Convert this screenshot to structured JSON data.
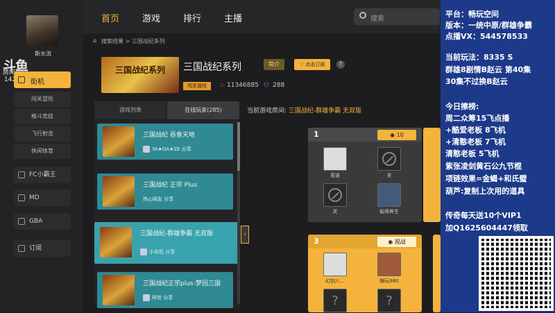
{
  "sidebar": {
    "username": "斯水流",
    "watermark": {
      "logo": "斗鱼",
      "room": "房间号",
      "id": "1425"
    },
    "active_item": "街机",
    "sub_items": [
      "闯关冒险",
      "格斗竞技",
      "飞行射击",
      "休闲体育"
    ],
    "items": [
      "FC小霸王",
      "MD",
      "GBA",
      "订阅"
    ]
  },
  "nav": {
    "items": [
      "首页",
      "游戏",
      "排行",
      "主播"
    ],
    "search_placeholder": "搜索"
  },
  "breadcrumb": [
    "搜索结果",
    "三国战纪系列"
  ],
  "game": {
    "banner_text": "三国战纪系列",
    "title": "三国战纪系列",
    "intro_label": "简介",
    "subscribe_label": "点击订阅",
    "tag": "闯关冒险",
    "popularity": "11346885",
    "followers": "288"
  },
  "tabs": {
    "list": "游戏列表",
    "players": "在线玩家(285)"
  },
  "current_room": {
    "label": "当前游戏房间:",
    "value": "三国战纪-群雄争霸 无双版"
  },
  "game_list": [
    {
      "title": "三国战纪 吞食天地",
      "user": "YA★OA★ZE",
      "share": "分享"
    },
    {
      "title": "三国战纪 正宗 Plus",
      "user": "热心网友",
      "share": "分享"
    },
    {
      "title": "三国战纪-群雄争霸 无双版",
      "user": "小灰机",
      "share": "分享"
    },
    {
      "title": "三国战纪正宗plus-梦回三国",
      "user": "阿信",
      "share": "分享"
    }
  ],
  "rooms": [
    {
      "num": "1",
      "badge": "10",
      "seats": [
        "宵诺",
        "关",
        "关",
        "偷师养生"
      ]
    },
    {
      "num": "3",
      "badge": "观战",
      "seats": [
        "幻剑八...",
        "狮玩980"
      ]
    }
  ],
  "overlay": {
    "lines_top": [
      "平台：畅玩空间",
      "版本：一统中原/群雄争霸",
      "点播VX：544578533"
    ],
    "lines_mid": [
      "当前玩法：8335 S",
      "群雄8剧情B赵云 第40集",
      "30集不过换B赵云"
    ],
    "lines_today": [
      "今日擦榜:",
      "周二众筹15飞点播",
      "+酷爱老板 8飞机",
      "+清憨老板 7飞机",
      "清憨老板 5飞机",
      "  紫张凌剑黄石公九节棍",
      "项链效果=金蝎+和氏璧",
      "葫芦:复制上次用的道具"
    ],
    "lines_bottom": [
      "传奇每天送10个VIP1",
      "加Q1625604447领取"
    ]
  }
}
